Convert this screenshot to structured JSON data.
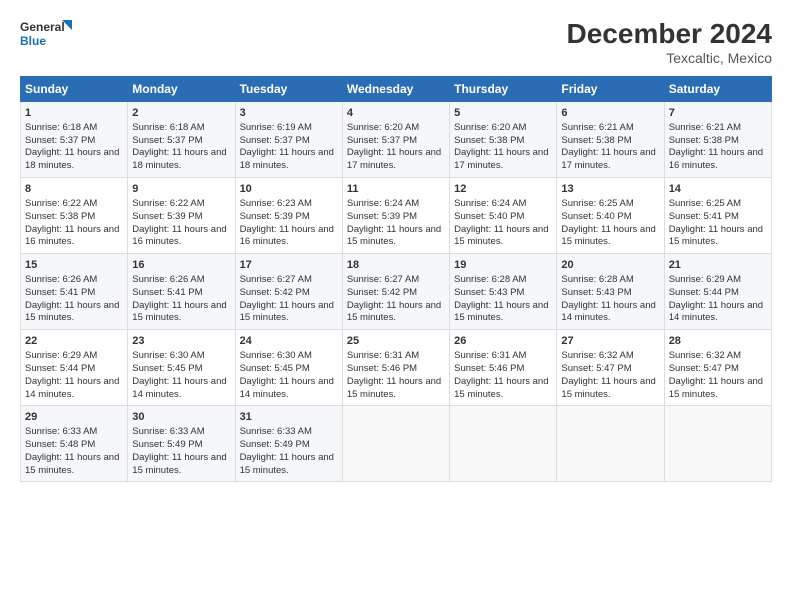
{
  "logo": {
    "line1": "General",
    "line2": "Blue"
  },
  "title": "December 2024",
  "subtitle": "Texcaltic, Mexico",
  "days_of_week": [
    "Sunday",
    "Monday",
    "Tuesday",
    "Wednesday",
    "Thursday",
    "Friday",
    "Saturday"
  ],
  "weeks": [
    [
      {
        "day": "1",
        "sunrise": "Sunrise: 6:18 AM",
        "sunset": "Sunset: 5:37 PM",
        "daylight": "Daylight: 11 hours and 18 minutes."
      },
      {
        "day": "2",
        "sunrise": "Sunrise: 6:18 AM",
        "sunset": "Sunset: 5:37 PM",
        "daylight": "Daylight: 11 hours and 18 minutes."
      },
      {
        "day": "3",
        "sunrise": "Sunrise: 6:19 AM",
        "sunset": "Sunset: 5:37 PM",
        "daylight": "Daylight: 11 hours and 18 minutes."
      },
      {
        "day": "4",
        "sunrise": "Sunrise: 6:20 AM",
        "sunset": "Sunset: 5:37 PM",
        "daylight": "Daylight: 11 hours and 17 minutes."
      },
      {
        "day": "5",
        "sunrise": "Sunrise: 6:20 AM",
        "sunset": "Sunset: 5:38 PM",
        "daylight": "Daylight: 11 hours and 17 minutes."
      },
      {
        "day": "6",
        "sunrise": "Sunrise: 6:21 AM",
        "sunset": "Sunset: 5:38 PM",
        "daylight": "Daylight: 11 hours and 17 minutes."
      },
      {
        "day": "7",
        "sunrise": "Sunrise: 6:21 AM",
        "sunset": "Sunset: 5:38 PM",
        "daylight": "Daylight: 11 hours and 16 minutes."
      }
    ],
    [
      {
        "day": "8",
        "sunrise": "Sunrise: 6:22 AM",
        "sunset": "Sunset: 5:38 PM",
        "daylight": "Daylight: 11 hours and 16 minutes."
      },
      {
        "day": "9",
        "sunrise": "Sunrise: 6:22 AM",
        "sunset": "Sunset: 5:39 PM",
        "daylight": "Daylight: 11 hours and 16 minutes."
      },
      {
        "day": "10",
        "sunrise": "Sunrise: 6:23 AM",
        "sunset": "Sunset: 5:39 PM",
        "daylight": "Daylight: 11 hours and 16 minutes."
      },
      {
        "day": "11",
        "sunrise": "Sunrise: 6:24 AM",
        "sunset": "Sunset: 5:39 PM",
        "daylight": "Daylight: 11 hours and 15 minutes."
      },
      {
        "day": "12",
        "sunrise": "Sunrise: 6:24 AM",
        "sunset": "Sunset: 5:40 PM",
        "daylight": "Daylight: 11 hours and 15 minutes."
      },
      {
        "day": "13",
        "sunrise": "Sunrise: 6:25 AM",
        "sunset": "Sunset: 5:40 PM",
        "daylight": "Daylight: 11 hours and 15 minutes."
      },
      {
        "day": "14",
        "sunrise": "Sunrise: 6:25 AM",
        "sunset": "Sunset: 5:41 PM",
        "daylight": "Daylight: 11 hours and 15 minutes."
      }
    ],
    [
      {
        "day": "15",
        "sunrise": "Sunrise: 6:26 AM",
        "sunset": "Sunset: 5:41 PM",
        "daylight": "Daylight: 11 hours and 15 minutes."
      },
      {
        "day": "16",
        "sunrise": "Sunrise: 6:26 AM",
        "sunset": "Sunset: 5:41 PM",
        "daylight": "Daylight: 11 hours and 15 minutes."
      },
      {
        "day": "17",
        "sunrise": "Sunrise: 6:27 AM",
        "sunset": "Sunset: 5:42 PM",
        "daylight": "Daylight: 11 hours and 15 minutes."
      },
      {
        "day": "18",
        "sunrise": "Sunrise: 6:27 AM",
        "sunset": "Sunset: 5:42 PM",
        "daylight": "Daylight: 11 hours and 15 minutes."
      },
      {
        "day": "19",
        "sunrise": "Sunrise: 6:28 AM",
        "sunset": "Sunset: 5:43 PM",
        "daylight": "Daylight: 11 hours and 15 minutes."
      },
      {
        "day": "20",
        "sunrise": "Sunrise: 6:28 AM",
        "sunset": "Sunset: 5:43 PM",
        "daylight": "Daylight: 11 hours and 14 minutes."
      },
      {
        "day": "21",
        "sunrise": "Sunrise: 6:29 AM",
        "sunset": "Sunset: 5:44 PM",
        "daylight": "Daylight: 11 hours and 14 minutes."
      }
    ],
    [
      {
        "day": "22",
        "sunrise": "Sunrise: 6:29 AM",
        "sunset": "Sunset: 5:44 PM",
        "daylight": "Daylight: 11 hours and 14 minutes."
      },
      {
        "day": "23",
        "sunrise": "Sunrise: 6:30 AM",
        "sunset": "Sunset: 5:45 PM",
        "daylight": "Daylight: 11 hours and 14 minutes."
      },
      {
        "day": "24",
        "sunrise": "Sunrise: 6:30 AM",
        "sunset": "Sunset: 5:45 PM",
        "daylight": "Daylight: 11 hours and 14 minutes."
      },
      {
        "day": "25",
        "sunrise": "Sunrise: 6:31 AM",
        "sunset": "Sunset: 5:46 PM",
        "daylight": "Daylight: 11 hours and 15 minutes."
      },
      {
        "day": "26",
        "sunrise": "Sunrise: 6:31 AM",
        "sunset": "Sunset: 5:46 PM",
        "daylight": "Daylight: 11 hours and 15 minutes."
      },
      {
        "day": "27",
        "sunrise": "Sunrise: 6:32 AM",
        "sunset": "Sunset: 5:47 PM",
        "daylight": "Daylight: 11 hours and 15 minutes."
      },
      {
        "day": "28",
        "sunrise": "Sunrise: 6:32 AM",
        "sunset": "Sunset: 5:47 PM",
        "daylight": "Daylight: 11 hours and 15 minutes."
      }
    ],
    [
      {
        "day": "29",
        "sunrise": "Sunrise: 6:33 AM",
        "sunset": "Sunset: 5:48 PM",
        "daylight": "Daylight: 11 hours and 15 minutes."
      },
      {
        "day": "30",
        "sunrise": "Sunrise: 6:33 AM",
        "sunset": "Sunset: 5:49 PM",
        "daylight": "Daylight: 11 hours and 15 minutes."
      },
      {
        "day": "31",
        "sunrise": "Sunrise: 6:33 AM",
        "sunset": "Sunset: 5:49 PM",
        "daylight": "Daylight: 11 hours and 15 minutes."
      },
      null,
      null,
      null,
      null
    ]
  ]
}
